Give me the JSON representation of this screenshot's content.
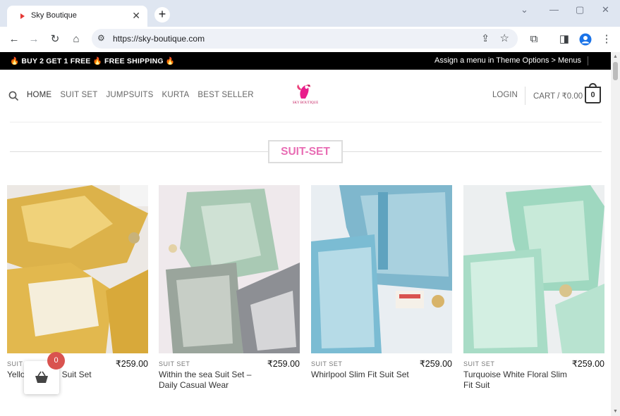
{
  "browser": {
    "tab_title": "Sky Boutique",
    "tab_close": "✕",
    "new_tab": "+",
    "url": "https://sky-boutique.com",
    "window_controls": [
      "⌄",
      "—",
      "▢",
      "✕"
    ]
  },
  "promo": {
    "left_text": "🔥 BUY 2 GET 1 FREE 🔥 FREE SHIPPING 🔥",
    "right_text": "Assign a menu in Theme Options > Menus"
  },
  "header": {
    "nav": [
      "HOME",
      "SUIT SET",
      "JUMPSUITS",
      "KURTA",
      "BEST SELLER"
    ],
    "login": "LOGIN",
    "cart_label": "CART / ₹0.00",
    "cart_count": "0",
    "logo_text": "SKY BOUTIQUE"
  },
  "section": {
    "title": "SUIT-SET"
  },
  "products": [
    {
      "category": "SUIT SET",
      "price": "₹259.00",
      "name": "Yellow Blouse Suit Set"
    },
    {
      "category": "SUIT SET",
      "price": "₹259.00",
      "name": "Within the sea Suit Set – Daily Casual Wear"
    },
    {
      "category": "SUIT SET",
      "price": "₹259.00",
      "name": "Whirlpool Slim Fit Suit Set"
    },
    {
      "category": "SUIT SET",
      "price": "₹259.00",
      "name": "Turquoise White Floral Slim Fit Suit"
    }
  ],
  "mini_cart": {
    "count": "0"
  },
  "colors": {
    "accent": "#e86db4",
    "promo_bg": "#000000",
    "badge": "#d9534f"
  },
  "icons": [
    "favicon-icon",
    "back-icon",
    "forward-icon",
    "reload-icon",
    "home-icon",
    "site-info-icon",
    "share-icon",
    "star-icon",
    "extensions-icon",
    "sidepanel-icon",
    "profile-icon",
    "menu-icon",
    "search-icon",
    "basket-icon"
  ]
}
